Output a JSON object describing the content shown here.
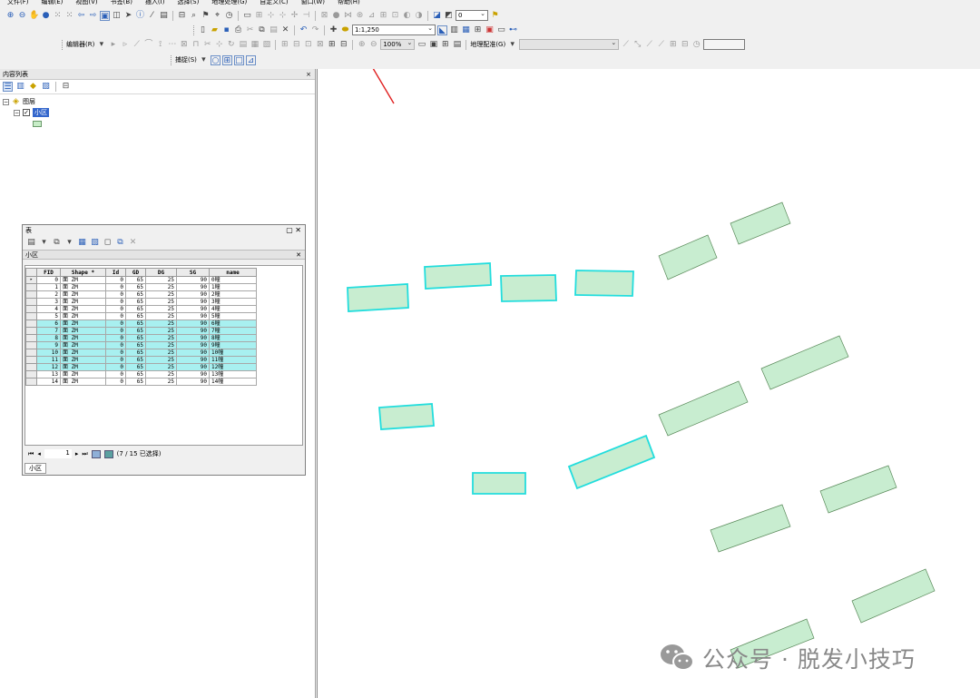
{
  "menu": [
    "文件(F)",
    "编辑(E)",
    "视图(V)",
    "书签(B)",
    "插入(I)",
    "选择(S)",
    "地理处理(G)",
    "自定义(C)",
    "窗口(W)",
    "帮助(H)"
  ],
  "toolbar": {
    "ref_scale_value": "0",
    "map_scale": "1:1,250",
    "editor_label": "编辑器(R)",
    "zoom_percent": "100%",
    "georef_label": "地理配准(G)",
    "snapping_label": "捕捉(S)"
  },
  "toc": {
    "title": "内容列表",
    "close_glyph": "× ",
    "root_layer": "图层",
    "layer": "小区"
  },
  "table_window": {
    "title": "表",
    "sub_title": "小区",
    "columns": [
      "FID",
      "Shape *",
      "Id",
      "GD",
      "DG",
      "SG",
      "name"
    ],
    "rows": [
      {
        "fid": "0",
        "shape": "面 ZM",
        "id": "0",
        "gd": "65",
        "dg": "25",
        "sg": "90",
        "name": "0幢",
        "hl": false
      },
      {
        "fid": "1",
        "shape": "面 ZM",
        "id": "0",
        "gd": "65",
        "dg": "25",
        "sg": "90",
        "name": "1幢",
        "hl": false
      },
      {
        "fid": "2",
        "shape": "面 ZM",
        "id": "0",
        "gd": "65",
        "dg": "25",
        "sg": "90",
        "name": "2幢",
        "hl": false
      },
      {
        "fid": "3",
        "shape": "面 ZM",
        "id": "0",
        "gd": "65",
        "dg": "25",
        "sg": "90",
        "name": "3幢",
        "hl": false
      },
      {
        "fid": "4",
        "shape": "面 ZM",
        "id": "0",
        "gd": "65",
        "dg": "25",
        "sg": "90",
        "name": "4幢",
        "hl": false
      },
      {
        "fid": "5",
        "shape": "面 ZM",
        "id": "0",
        "gd": "65",
        "dg": "25",
        "sg": "90",
        "name": "5幢",
        "hl": false
      },
      {
        "fid": "6",
        "shape": "面 ZM",
        "id": "0",
        "gd": "65",
        "dg": "25",
        "sg": "90",
        "name": "6幢",
        "hl": true
      },
      {
        "fid": "7",
        "shape": "面 ZM",
        "id": "0",
        "gd": "65",
        "dg": "25",
        "sg": "90",
        "name": "7幢",
        "hl": true
      },
      {
        "fid": "8",
        "shape": "面 ZM",
        "id": "0",
        "gd": "65",
        "dg": "25",
        "sg": "90",
        "name": "8幢",
        "hl": true
      },
      {
        "fid": "9",
        "shape": "面 ZM",
        "id": "0",
        "gd": "65",
        "dg": "25",
        "sg": "90",
        "name": "9幢",
        "hl": true
      },
      {
        "fid": "10",
        "shape": "面 ZM",
        "id": "0",
        "gd": "65",
        "dg": "25",
        "sg": "90",
        "name": "10幢",
        "hl": true
      },
      {
        "fid": "11",
        "shape": "面 ZM",
        "id": "0",
        "gd": "65",
        "dg": "25",
        "sg": "90",
        "name": "11幢",
        "hl": true
      },
      {
        "fid": "12",
        "shape": "面 ZM",
        "id": "0",
        "gd": "65",
        "dg": "25",
        "sg": "90",
        "name": "12幢",
        "hl": true
      },
      {
        "fid": "13",
        "shape": "面 ZM",
        "id": "0",
        "gd": "65",
        "dg": "25",
        "sg": "90",
        "name": "13幢",
        "hl": false
      },
      {
        "fid": "14",
        "shape": "面 ZM",
        "id": "0",
        "gd": "65",
        "dg": "25",
        "sg": "90",
        "name": "14幢",
        "hl": false
      }
    ],
    "record_number": "1",
    "selection_status": "(7 / 15 已选择)",
    "tab": "小区"
  },
  "map": {
    "fill_color": "#c8edd0",
    "selected_outline": "#22dddd",
    "normal_outline": "#5a8a5a",
    "annotation_arrow_color": "#e02020"
  },
  "watermark": "公众号 · 脱发小技巧"
}
